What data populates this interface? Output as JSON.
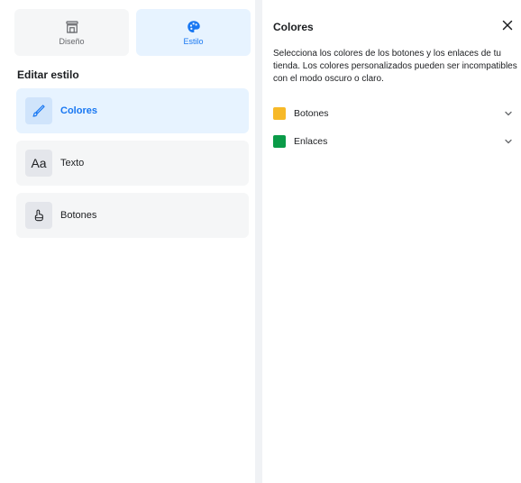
{
  "tabs": {
    "design_label": "Diseño",
    "style_label": "Estilo"
  },
  "left": {
    "section_title": "Editar estilo",
    "items": [
      {
        "label": "Colores"
      },
      {
        "label": "Texto",
        "icon_text": "Aa"
      },
      {
        "label": "Botones"
      }
    ]
  },
  "right": {
    "title": "Colores",
    "description": "Selecciona los colores de los botones y los enlaces de tu tienda. Los colores personalizados pueden ser incompatibles con el modo oscuro o claro.",
    "options": [
      {
        "label": "Botones",
        "color": "#f7b928"
      },
      {
        "label": "Enlaces",
        "color": "#0a9b48"
      }
    ]
  },
  "colors": {
    "accent": "#1877f2"
  },
  "icons": {
    "design_tab": "storefront-icon",
    "style_tab": "palette-icon",
    "colors_item": "brush-icon",
    "text_item": "text-aa-icon",
    "buttons_item": "tap-hand-icon",
    "close": "close-icon",
    "expand": "chevron-down-icon"
  }
}
